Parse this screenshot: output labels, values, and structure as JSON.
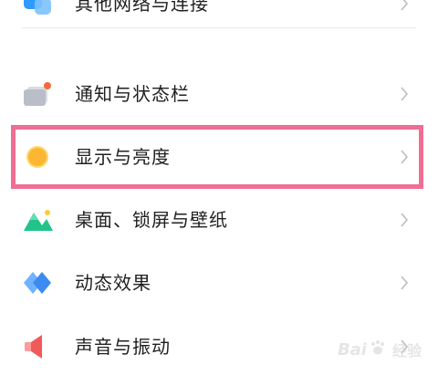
{
  "settings": {
    "items": [
      {
        "label": "其他网络与连接",
        "icon": "network-icon"
      },
      {
        "label": "通知与状态栏",
        "icon": "notification-icon"
      },
      {
        "label": "显示与亮度",
        "icon": "brightness-icon"
      },
      {
        "label": "桌面、锁屏与壁纸",
        "icon": "wallpaper-icon"
      },
      {
        "label": "动态效果",
        "icon": "animation-icon"
      },
      {
        "label": "声音与振动",
        "icon": "sound-icon"
      }
    ],
    "highlighted_item": "显示与亮度"
  },
  "watermark": {
    "text": "Bai",
    "subtext": "经验"
  },
  "colors": {
    "highlight_border": "#ef6e93",
    "chevron": "#bdbdbd",
    "text": "#1f1f1f",
    "brightness_icon": "#fbb731",
    "animation_icon": "#3b8bf0",
    "sound_icon": "#f05a5a",
    "wallpaper_icon": "#22c38a",
    "network_icon": "#2f9bff",
    "notification_badge": "#f36a3c"
  }
}
